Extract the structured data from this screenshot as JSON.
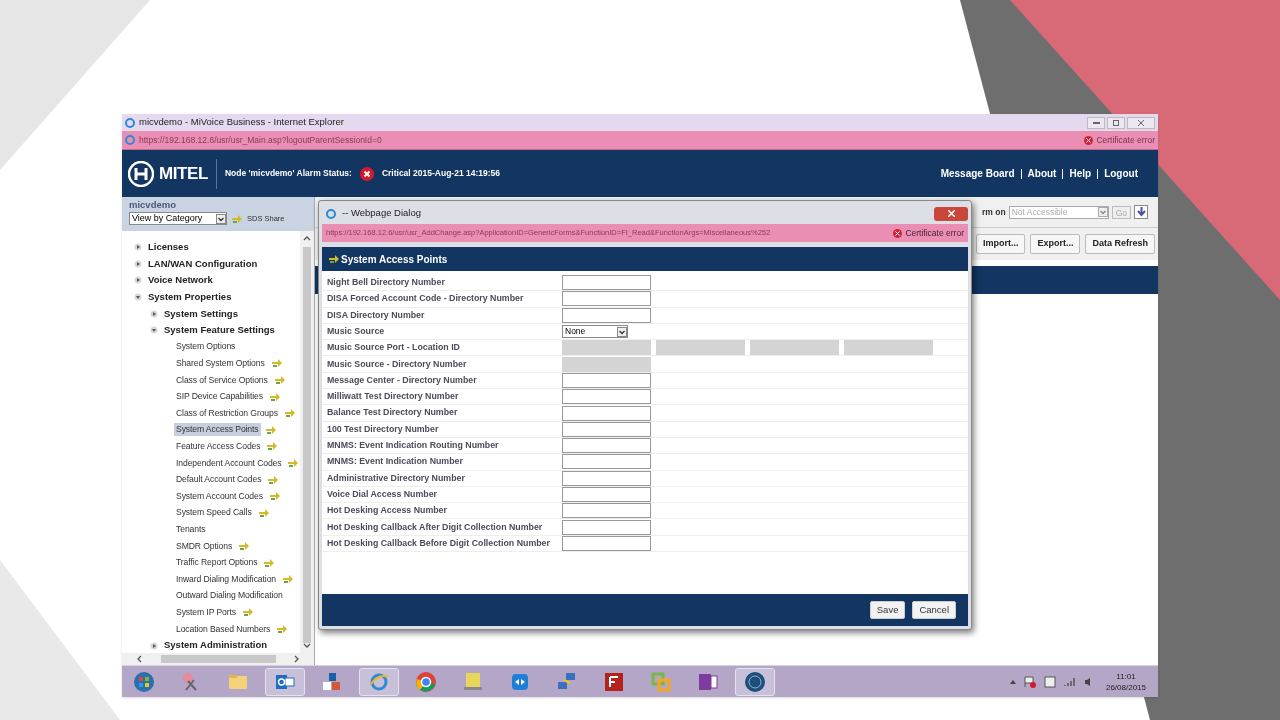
{
  "browser": {
    "title": "micvdemo - MiVoice Business - Internet Explorer",
    "url": "https://192.168.12.6/usr/usr_Main.asp?logoutParentSessionId=0",
    "cert": "Certificate error"
  },
  "header": {
    "logo": "MITEL",
    "alarm_label": "Node 'micvdemo' Alarm Status:",
    "alarm": "Critical 2015-Aug-21 14:19:56",
    "links": [
      "Message Board",
      "About",
      "Help",
      "Logout"
    ]
  },
  "sidebar": {
    "node": "micvdemo",
    "view": "View by Category",
    "share": "SDS Share",
    "tree": [
      {
        "label": "Licenses",
        "expanded": false,
        "selected": false
      },
      {
        "label": "LAN/WAN Configuration",
        "expanded": false,
        "selected": false
      },
      {
        "label": "Voice Network",
        "expanded": false,
        "selected": false
      },
      {
        "label": "System Properties",
        "expanded": true,
        "selected": false,
        "children": [
          {
            "label": "System Settings",
            "expanded": false,
            "selected": false
          },
          {
            "label": "System Feature Settings",
            "expanded": true,
            "selected": false,
            "children": [
              {
                "label": "System Options",
                "shared": false,
                "selected": false
              },
              {
                "label": "Shared System Options",
                "shared": true,
                "selected": false
              },
              {
                "label": "Class of Service Options",
                "shared": true,
                "selected": false
              },
              {
                "label": "SIP Device Capabilities",
                "shared": true,
                "selected": false
              },
              {
                "label": "Class of Restriction Groups",
                "shared": true,
                "selected": false
              },
              {
                "label": "System Access Points",
                "shared": true,
                "selected": true
              },
              {
                "label": "Feature Access Codes",
                "shared": true,
                "selected": false
              },
              {
                "label": "Independent Account Codes",
                "shared": true,
                "selected": false
              },
              {
                "label": "Default Account Codes",
                "shared": true,
                "selected": false
              },
              {
                "label": "System Account Codes",
                "shared": true,
                "selected": false
              },
              {
                "label": "System Speed Calls",
                "shared": true,
                "selected": false
              },
              {
                "label": "Tenants",
                "shared": false,
                "selected": false
              },
              {
                "label": "SMDR Options",
                "shared": true,
                "selected": false
              },
              {
                "label": "Traffic Report Options",
                "shared": true,
                "selected": false
              },
              {
                "label": "Inward Dialing Modification",
                "shared": true,
                "selected": false
              },
              {
                "label": "Outward Dialing Modification",
                "shared": false,
                "selected": false
              },
              {
                "label": "System IP Ports",
                "shared": true,
                "selected": false
              },
              {
                "label": "Location Based Numbers",
                "shared": true,
                "selected": false
              }
            ]
          },
          {
            "label": "System Administration",
            "expanded": false,
            "selected": false
          }
        ]
      }
    ]
  },
  "toolbar": {
    "perform_label": "rm on",
    "perform_value": "Not Accessible",
    "go": "Go",
    "buttons": [
      "Import...",
      "Export...",
      "Data Refresh"
    ]
  },
  "dialog": {
    "title": "-- Webpage Dialog",
    "url": "https://192.168.12.6/usr/usr_AddChange.asp?ApplicationID=GenericForms&FunctionID=FI_Read&FunctionArgs=Miscellaneous%252",
    "cert": "Certificate error",
    "heading": "System Access Points",
    "fields": [
      {
        "label": "Night Bell Directory Number",
        "kind": "text",
        "disabled": false
      },
      {
        "label": "DISA Forced Account Code - Directory Number",
        "kind": "text",
        "disabled": false
      },
      {
        "label": "DISA Directory Number",
        "kind": "text",
        "disabled": false
      },
      {
        "label": "Music Source",
        "kind": "select",
        "value": "None"
      },
      {
        "label": "Music Source Port - Location ID",
        "kind": "multi",
        "disabled": true
      },
      {
        "label": "Music Source - Directory Number",
        "kind": "text",
        "disabled": true
      },
      {
        "label": "Message Center - Directory Number",
        "kind": "text",
        "disabled": false
      },
      {
        "label": "Milliwatt Test Directory Number",
        "kind": "text",
        "disabled": false
      },
      {
        "label": "Balance Test Directory Number",
        "kind": "text",
        "disabled": false
      },
      {
        "label": "100 Test Directory Number",
        "kind": "text",
        "disabled": false
      },
      {
        "label": "MNMS: Event Indication Routing Number",
        "kind": "text",
        "disabled": false
      },
      {
        "label": "MNMS: Event Indication Number",
        "kind": "text",
        "disabled": false
      },
      {
        "label": "Administrative Directory Number",
        "kind": "text",
        "disabled": false
      },
      {
        "label": "Voice Dial Access Number",
        "kind": "text",
        "disabled": false
      },
      {
        "label": "Hot Desking Access Number",
        "kind": "text",
        "disabled": false
      },
      {
        "label": "Hot Desking Callback After Digit Collection Number",
        "kind": "text",
        "disabled": false
      },
      {
        "label": "Hot Desking Callback Before Digit Collection Number",
        "kind": "text",
        "disabled": false
      }
    ],
    "buttons": [
      "Save",
      "Cancel"
    ]
  },
  "taskbar": {
    "time": "11:01",
    "date": "26/08/2015"
  }
}
